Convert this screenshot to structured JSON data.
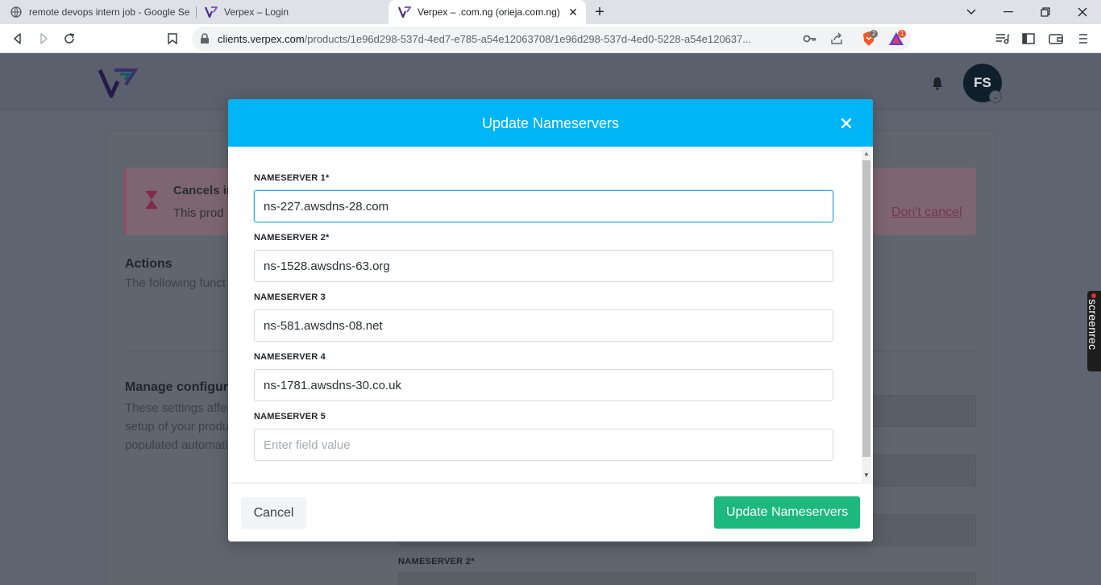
{
  "browser": {
    "tabs": [
      {
        "title": "remote devops intern job - Google Se",
        "icon": "globe-icon",
        "active": false
      },
      {
        "title": "Verpex – Login",
        "icon": "verpex-favicon",
        "active": false
      },
      {
        "title": "Verpex – .com.ng (orieja.com.ng)",
        "icon": "verpex-favicon",
        "active": true
      }
    ],
    "url_host": "clients.verpex.com",
    "url_path": "/products/1e96d298-537d-4ed7-e785-a54e12063708/1e96d298-537d-4ed0-5228-a54e120637...",
    "brave_badge": "2",
    "alert_badge": "1"
  },
  "page": {
    "avatar_initials": "FS",
    "banner_title": "Cancels in",
    "banner_text": "This prod",
    "dont_cancel": "Don't cancel",
    "actions_heading": "Actions",
    "actions_text": "The following funct",
    "manage_heading": "Manage configura",
    "manage_text": "These settings affec setup of your produ populated automati",
    "bg_label": "NAMESERVER 2*"
  },
  "modal": {
    "title": "Update Nameservers",
    "fields": [
      {
        "label": "NAMESERVER 1*",
        "value": "ns-227.awsdns-28.com",
        "placeholder": "Enter field value"
      },
      {
        "label": "NAMESERVER 2*",
        "value": "ns-1528.awsdns-63.org",
        "placeholder": "Enter field value"
      },
      {
        "label": "NAMESERVER 3",
        "value": "ns-581.awsdns-08.net",
        "placeholder": "Enter field value"
      },
      {
        "label": "NAMESERVER 4",
        "value": "ns-1781.awsdns-30.co.uk",
        "placeholder": "Enter field value"
      },
      {
        "label": "NAMESERVER 5",
        "value": "",
        "placeholder": "Enter field value"
      }
    ],
    "cancel_label": "Cancel",
    "submit_label": "Update Nameservers"
  },
  "overlay": {
    "screenrec_text": "screenrec"
  },
  "colors": {
    "modal_header": "#00b5f5",
    "submit_button": "#1cb87d",
    "focus_border": "#2ea7e0"
  }
}
